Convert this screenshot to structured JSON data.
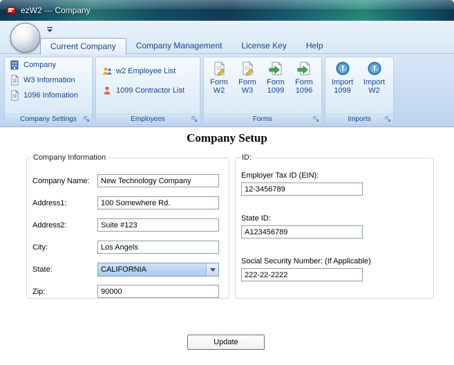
{
  "window": {
    "title": "ezW2 --- Company"
  },
  "colors": {
    "accent": "#15428b",
    "titlebar": "#17546e",
    "combo_selection": "#a9ccee"
  },
  "ribbon": {
    "tabs": [
      {
        "label": "Current Company",
        "active": true
      },
      {
        "label": "Company Management",
        "active": false
      },
      {
        "label": "License Key",
        "active": false
      },
      {
        "label": "Help",
        "active": false
      }
    ],
    "groups": {
      "company_settings": {
        "label": "Company Settings",
        "items": [
          {
            "label": "Company",
            "icon": "building-icon"
          },
          {
            "label": "W3 Information",
            "icon": "document-icon"
          },
          {
            "label": "1096 Infomation",
            "icon": "document-icon"
          }
        ]
      },
      "employees": {
        "label": "Employees",
        "items": [
          {
            "label": "w2 Employee List",
            "icon": "employees-icon"
          },
          {
            "label": "1099 Contractor List",
            "icon": "contractor-icon"
          }
        ]
      },
      "forms": {
        "label": "Forms",
        "items": [
          {
            "line1": "Form",
            "line2": "W2",
            "icon": "form-edit-icon"
          },
          {
            "line1": "Form",
            "line2": "W3",
            "icon": "form-edit-icon"
          },
          {
            "line1": "Form",
            "line2": "1099",
            "icon": "form-arrow-icon"
          },
          {
            "line1": "Form",
            "line2": "1096",
            "icon": "form-arrow-icon"
          }
        ]
      },
      "imports": {
        "label": "Imports",
        "items": [
          {
            "line1": "Import",
            "line2": "1099",
            "icon": "import-icon"
          },
          {
            "line1": "Import",
            "line2": "W2",
            "icon": "import-icon"
          }
        ]
      }
    }
  },
  "main": {
    "heading": "Company Setup",
    "company_info": {
      "legend": "Company Information",
      "fields": {
        "company_name": {
          "label": "Company Name:",
          "value": "New Technology Company"
        },
        "address1": {
          "label": "Address1:",
          "value": "100 Somewhere Rd."
        },
        "address2": {
          "label": "Address2:",
          "value": "Suite #123"
        },
        "city": {
          "label": "City:",
          "value": "Los Angels"
        },
        "state": {
          "label": "State:",
          "value": "CALIFORNIA"
        },
        "zip": {
          "label": "Zip:",
          "value": "90000"
        }
      }
    },
    "id_section": {
      "legend": "ID:",
      "fields": {
        "ein": {
          "label": "Employer Tax ID (EIN):",
          "value": "12-3456789"
        },
        "state_id": {
          "label": "State ID:",
          "value": "A123456789"
        },
        "ssn": {
          "label": "Social Security Number: (If Applicable)",
          "value": "222-22-2222"
        }
      }
    },
    "update_button": "Update"
  }
}
